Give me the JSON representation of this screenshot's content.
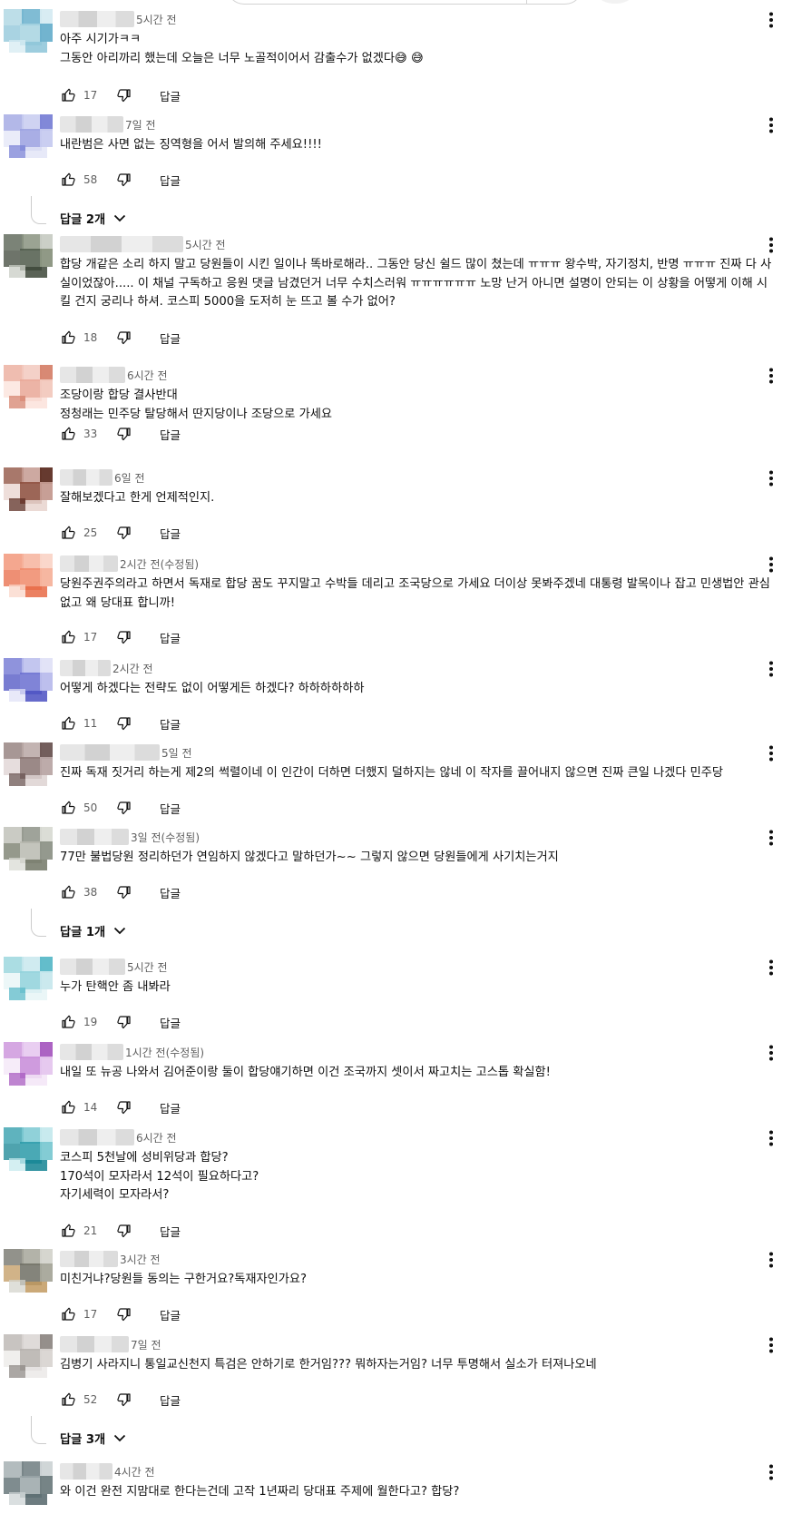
{
  "labels": {
    "reply": "답글"
  },
  "comments": [
    {
      "time": "5시간 전",
      "lines": [
        "아주 시기가ㅋㅋ",
        "그동안 아리까리 했는데 오늘은 너무 노골적이어서 감출수가 없겠다😅 😅"
      ],
      "likes": "17"
    },
    {
      "time": "7일 전",
      "lines": [
        "내란범은 사면 없는 징역형을 어서 발의해 주세요!!!!"
      ],
      "likes": "58",
      "replies": "답글 2개"
    },
    {
      "time": "5시간 전",
      "lines": [
        "합당 개같은 소리 하지 말고 당원들이 시킨 일이나 똑바로해라.. 그동안 당신 쉴드 많이 쳤는데 ㅠㅠㅠ 왕수박, 자기정치, 반명 ㅠㅠㅠ 진짜 다 사실이었잖아..... 이 채널 구독하고 응원 댓글 남겼던거 너무 수치스러워 ㅠㅠㅠㅠㅠㅠ 노망 난거 아니면 설명이 안되는 이 상황을 어떻게 이해 시킬 건지 궁리나 하셔. 코스피 5000을 도저히 눈 뜨고 볼 수가 없어?"
      ],
      "likes": "18"
    },
    {
      "time": "6시간 전",
      "lines": [
        "조당이랑 합당 결사반대",
        "정청래는  민주당 탈당해서  딴지당이나 조당으로 가세요"
      ],
      "likes": "33"
    },
    {
      "time": "6일 전",
      "lines": [
        "잘해보겠다고 한게 언제적인지."
      ],
      "likes": "25"
    },
    {
      "time": "2시간 전(수정됨)",
      "lines": [
        "당원주권주의라고 하면서 독재로 합당 꿈도 꾸지말고 수박들 데리고 조국당으로 가세요 더이상 못봐주겠네 대통령 발목이나 잡고 민생법안 관심없고 왜 당대표 합니까!"
      ],
      "likes": "17"
    },
    {
      "time": "2시간 전",
      "lines": [
        "어떻게 하겠다는 전략도 없이 어떻게든 하겠다? 하하하하하하"
      ],
      "likes": "11"
    },
    {
      "time": "5일 전",
      "lines": [
        "진짜 독재 짓거리 하는게 제2의 썩렬이네 이 인간이 더하면 더했지 덜하지는 않네 이 작자를 끌어내지 않으면 진짜 큰일 나겠다 민주당"
      ],
      "likes": "50"
    },
    {
      "time": "3일 전(수정됨)",
      "lines": [
        "77만 불법당원 정리하던가 연임하지 않겠다고 말하던가~~ 그렇지 않으면 당원들에게 사기치는거지"
      ],
      "likes": "38",
      "replies": "답글 1개"
    },
    {
      "time": "5시간 전",
      "lines": [
        "누가 탄핵안 좀 내봐라"
      ],
      "likes": "19"
    },
    {
      "time": "1시간 전(수정됨)",
      "lines": [
        "내일 또 뉴공 나와서 김어준이랑 둘이 합당얘기하면 이건 조국까지 셋이서 짜고치는 고스톱 확실함!"
      ],
      "likes": "14"
    },
    {
      "time": "6시간 전",
      "lines": [
        "코스피 5천날에 성비위당과 합당?",
        "170석이 모자라서 12석이 필요하다고?",
        "자기세력이 모자라서?"
      ],
      "likes": "21"
    },
    {
      "time": "3시간 전",
      "lines": [
        "미친거냐?당원들 동의는 구한거요?독재자인가요?"
      ],
      "likes": "17"
    },
    {
      "time": "7일 전",
      "lines": [
        "김병기 사라지니 통일교신천지 특검은 안하기로 한거임??? 뭐하자는거임? 너무 투명해서 실소가 터져나오네"
      ],
      "likes": "52",
      "replies": "답글 3개"
    },
    {
      "time": "4시간 전",
      "lines": [
        "와 이건 완전 지맘대로 한다는건데 고작 1년짜리 당대표 주제에 월한다고? 합당?"
      ],
      "likes": ""
    }
  ]
}
